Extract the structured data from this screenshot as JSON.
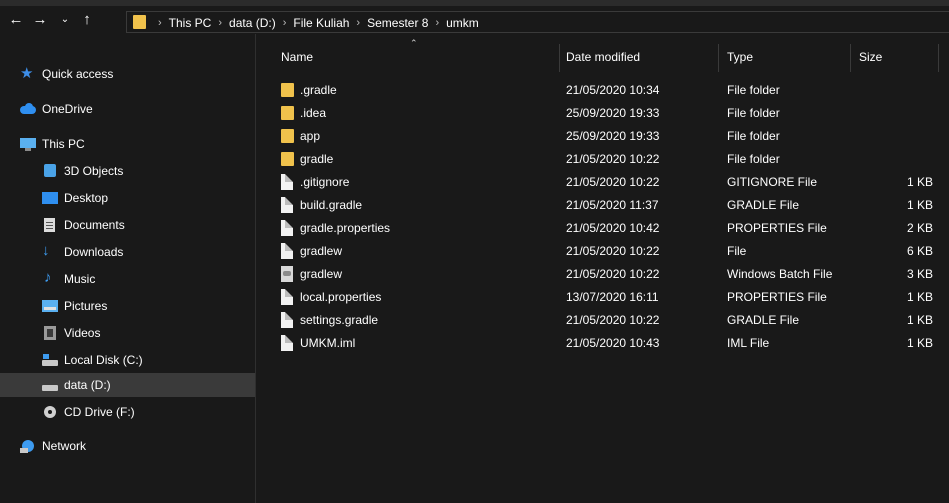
{
  "navigation": {
    "back_icon": "arrow-left-icon",
    "forward_icon": "arrow-right-icon",
    "recent_icon": "chevron-down-icon",
    "up_icon": "arrow-up-icon",
    "breadcrumbs": [
      "This PC",
      "data (D:)",
      "File Kuliah",
      "Semester 8",
      "umkm"
    ]
  },
  "sidebar": {
    "items": [
      {
        "label": "Quick access",
        "icon": "star-icon"
      },
      {
        "label": "OneDrive",
        "icon": "cloud-icon"
      },
      {
        "label": "This PC",
        "icon": "computer-icon"
      },
      {
        "label": "3D Objects",
        "icon": "cube-icon"
      },
      {
        "label": "Desktop",
        "icon": "desktop-icon"
      },
      {
        "label": "Documents",
        "icon": "document-icon"
      },
      {
        "label": "Downloads",
        "icon": "download-icon"
      },
      {
        "label": "Music",
        "icon": "music-note-icon"
      },
      {
        "label": "Pictures",
        "icon": "picture-icon"
      },
      {
        "label": "Videos",
        "icon": "film-icon"
      },
      {
        "label": "Local Disk (C:)",
        "icon": "drive-icon"
      },
      {
        "label": "data (D:)",
        "icon": "drive-icon",
        "selected": true
      },
      {
        "label": "CD Drive (F:)",
        "icon": "cd-icon"
      },
      {
        "label": "Network",
        "icon": "network-icon"
      }
    ]
  },
  "columns": {
    "name": "Name",
    "date": "Date modified",
    "type": "Type",
    "size": "Size"
  },
  "files": [
    {
      "name": ".gradle",
      "date": "21/05/2020 10:34",
      "type": "File folder",
      "size": "",
      "icon": "folder-icon"
    },
    {
      "name": ".idea",
      "date": "25/09/2020 19:33",
      "type": "File folder",
      "size": "",
      "icon": "folder-icon"
    },
    {
      "name": "app",
      "date": "25/09/2020 19:33",
      "type": "File folder",
      "size": "",
      "icon": "folder-icon"
    },
    {
      "name": "gradle",
      "date": "21/05/2020 10:22",
      "type": "File folder",
      "size": "",
      "icon": "folder-icon"
    },
    {
      "name": ".gitignore",
      "date": "21/05/2020 10:22",
      "type": "GITIGNORE File",
      "size": "1 KB",
      "icon": "file-icon"
    },
    {
      "name": "build.gradle",
      "date": "21/05/2020 11:37",
      "type": "GRADLE File",
      "size": "1 KB",
      "icon": "file-icon"
    },
    {
      "name": "gradle.properties",
      "date": "21/05/2020 10:42",
      "type": "PROPERTIES File",
      "size": "2 KB",
      "icon": "file-icon"
    },
    {
      "name": "gradlew",
      "date": "21/05/2020 10:22",
      "type": "File",
      "size": "6 KB",
      "icon": "file-icon"
    },
    {
      "name": "gradlew",
      "date": "21/05/2020 10:22",
      "type": "Windows Batch File",
      "size": "3 KB",
      "icon": "batch-file-icon"
    },
    {
      "name": "local.properties",
      "date": "13/07/2020 16:11",
      "type": "PROPERTIES File",
      "size": "1 KB",
      "icon": "file-icon"
    },
    {
      "name": "settings.gradle",
      "date": "21/05/2020 10:22",
      "type": "GRADLE File",
      "size": "1 KB",
      "icon": "file-icon"
    },
    {
      "name": "UMKM.iml",
      "date": "21/05/2020 10:43",
      "type": "IML File",
      "size": "1 KB",
      "icon": "file-icon"
    }
  ]
}
